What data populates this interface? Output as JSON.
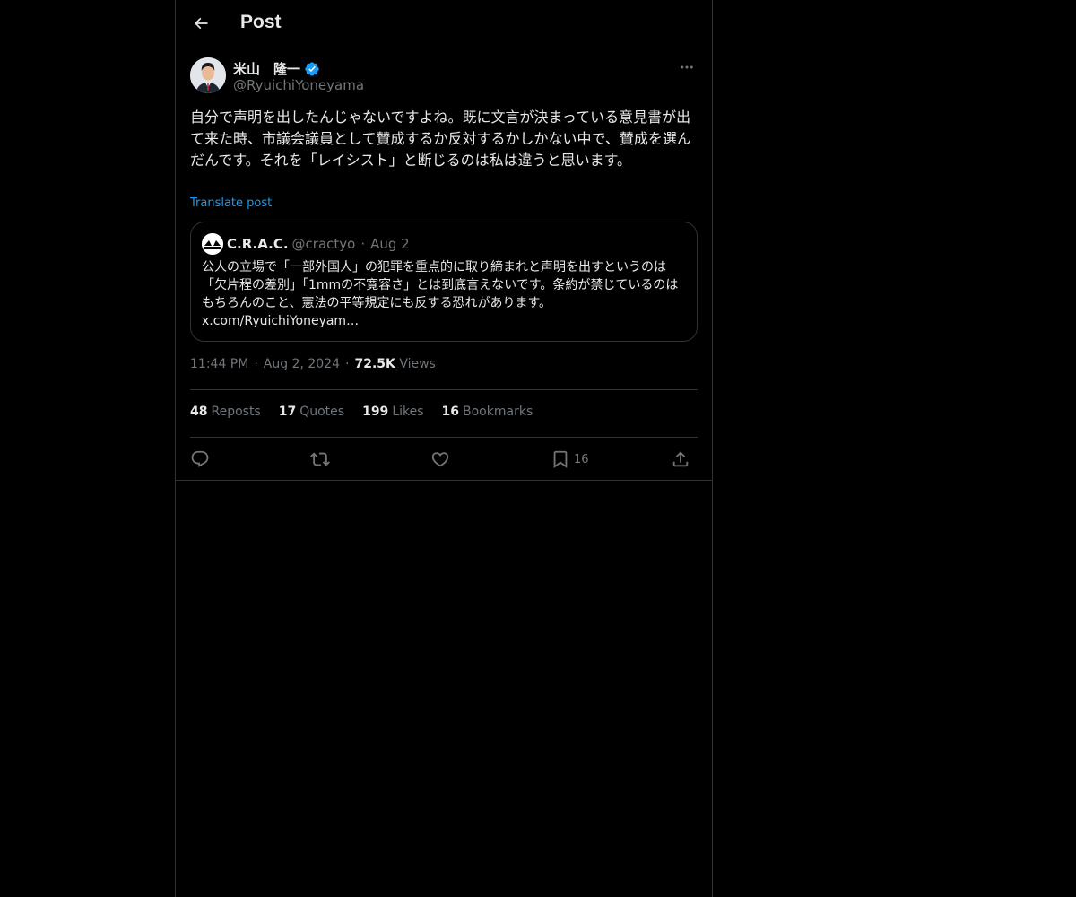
{
  "header": {
    "title": "Post",
    "back_icon": "arrow-left-icon"
  },
  "author": {
    "display_name": "米山　隆一",
    "handle": "@RyuichiYoneyama",
    "verified_icon": "verified-badge-icon",
    "verified_color": "#1d9bf0"
  },
  "tweet": {
    "text": "自分で声明を出したんじゃないですよね。既に文言が決まっている意見書が出て来た時、市議会議員として賛成するか反対するかしかない中で、賛成を選んだんです。それを「レイシスト」と断じるのは私は違うと思います。",
    "translate_label": "Translate post"
  },
  "quote": {
    "name": "C.R.A.C.",
    "handle": "@cractyo",
    "separator": "·",
    "date": "Aug 2",
    "text": "公人の立場で「一部外国人」の犯罪を重点的に取り締まれと声明を出すというのは「欠片程の差別」「1mmの不寛容さ」とは到底言えないです。条約が禁じているのはもちろんのこと、憲法の平等規定にも反する恐れがあります。",
    "link": "x.com/RyuichiYoneyam…"
  },
  "meta": {
    "time": "11:44 PM",
    "separator": "·",
    "date": "Aug 2, 2024",
    "views_count": "72.5K",
    "views_label": "Views"
  },
  "stats": {
    "reposts_count": "48",
    "reposts_label": "Reposts",
    "quotes_count": "17",
    "quotes_label": "Quotes",
    "likes_count": "199",
    "likes_label": "Likes",
    "bookmarks_count": "16",
    "bookmarks_label": "Bookmarks"
  },
  "actions": {
    "reply_icon": "reply-icon",
    "repost_icon": "repost-icon",
    "like_icon": "heart-icon",
    "bookmark_icon": "bookmark-icon",
    "bookmark_count": "16",
    "share_icon": "share-icon"
  },
  "colors": {
    "background": "#000000",
    "text": "#e7e9ea",
    "muted": "#71767b",
    "accent": "#1d9bf0",
    "border": "#2f3336"
  }
}
